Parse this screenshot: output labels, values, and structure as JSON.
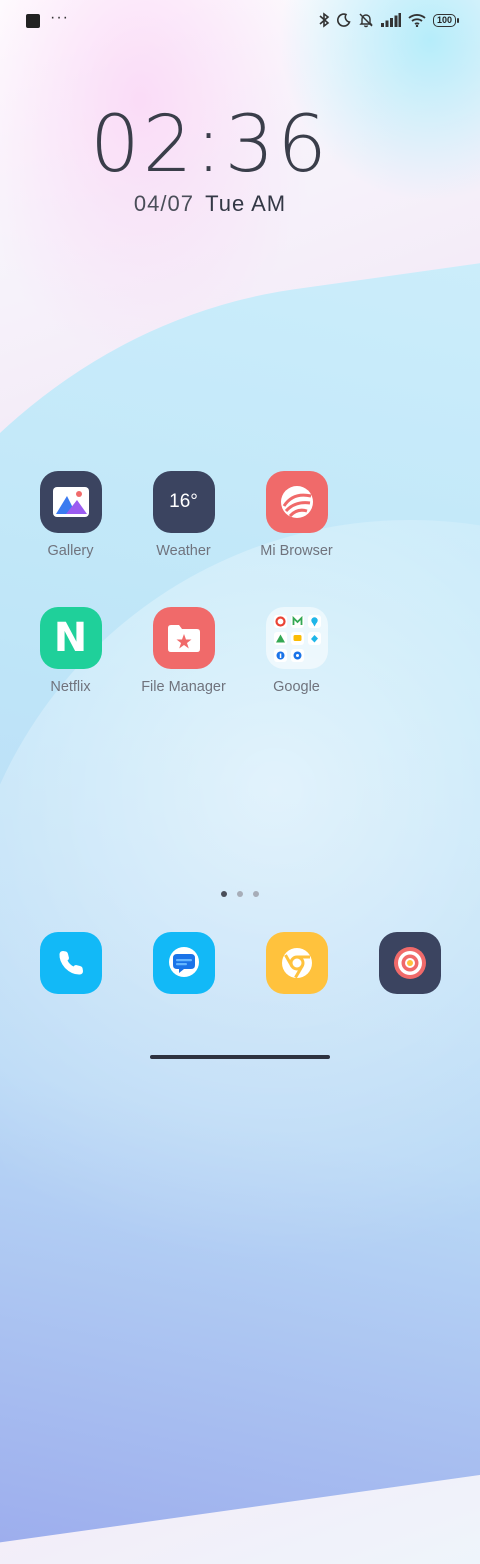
{
  "status": {
    "battery": "100"
  },
  "clock": {
    "time": "02:36",
    "date": "04/07",
    "weekday": "Tue AM"
  },
  "apps": [
    {
      "label": "Gallery"
    },
    {
      "label": "Weather",
      "temp": "16°"
    },
    {
      "label": "Mi Browser"
    },
    {
      "label": "Netflix",
      "glyph": "N"
    },
    {
      "label": "File Manager"
    },
    {
      "label": "Google"
    }
  ],
  "dock": [
    {
      "name": "phone-icon"
    },
    {
      "name": "messages-icon"
    },
    {
      "name": "chrome-icon"
    },
    {
      "name": "screen-recorder-icon"
    }
  ],
  "pager": {
    "pages": 3,
    "current": 1
  },
  "colors": {
    "gallery": "#3b4460",
    "weather": "#3b4460",
    "browser": "#f06a6a",
    "netflix": "#1fd09a",
    "files": "#f06a6a",
    "phone": "#12b9f7",
    "messages": "#12b9f7",
    "chrome": "#ffc23d",
    "recorder": "#3b4460"
  }
}
